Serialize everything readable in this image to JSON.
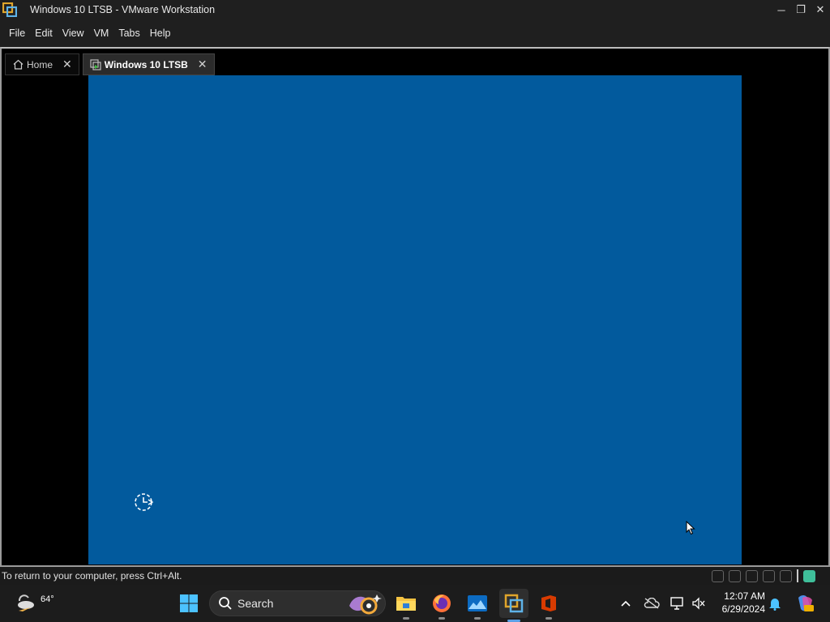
{
  "window": {
    "title": "Windows 10 LTSB - VMware Workstation",
    "controls": {
      "minimize": "─",
      "restore": "❐",
      "close": "✕"
    }
  },
  "menu": [
    "File",
    "Edit",
    "View",
    "VM",
    "Tabs",
    "Help"
  ],
  "tabs": [
    {
      "label": "Home",
      "icon": "home-icon",
      "active": false,
      "close": "✕"
    },
    {
      "label": "Windows 10 LTSB",
      "icon": "vm-icon",
      "active": true,
      "close": "✕"
    }
  ],
  "vm": {
    "background_color": "#025a9d",
    "state_icon": "loading-spinner-icon"
  },
  "status": {
    "text": "To return to your computer, press Ctrl+Alt."
  },
  "taskbar": {
    "weather": {
      "temp": "64°",
      "icon": "partly-cloudy-icon"
    },
    "search": {
      "label": "Search"
    },
    "apps": [
      {
        "name": "start-button",
        "icon": "windows-logo-icon"
      },
      {
        "name": "file-explorer",
        "icon": "folder-icon"
      },
      {
        "name": "firefox",
        "icon": "firefox-icon"
      },
      {
        "name": "photos",
        "icon": "photos-icon"
      },
      {
        "name": "vmware-workstation",
        "icon": "vmware-icon",
        "active": true
      },
      {
        "name": "office",
        "icon": "office-icon"
      }
    ],
    "clock": {
      "time": "12:07 AM",
      "date": "6/29/2024"
    }
  }
}
